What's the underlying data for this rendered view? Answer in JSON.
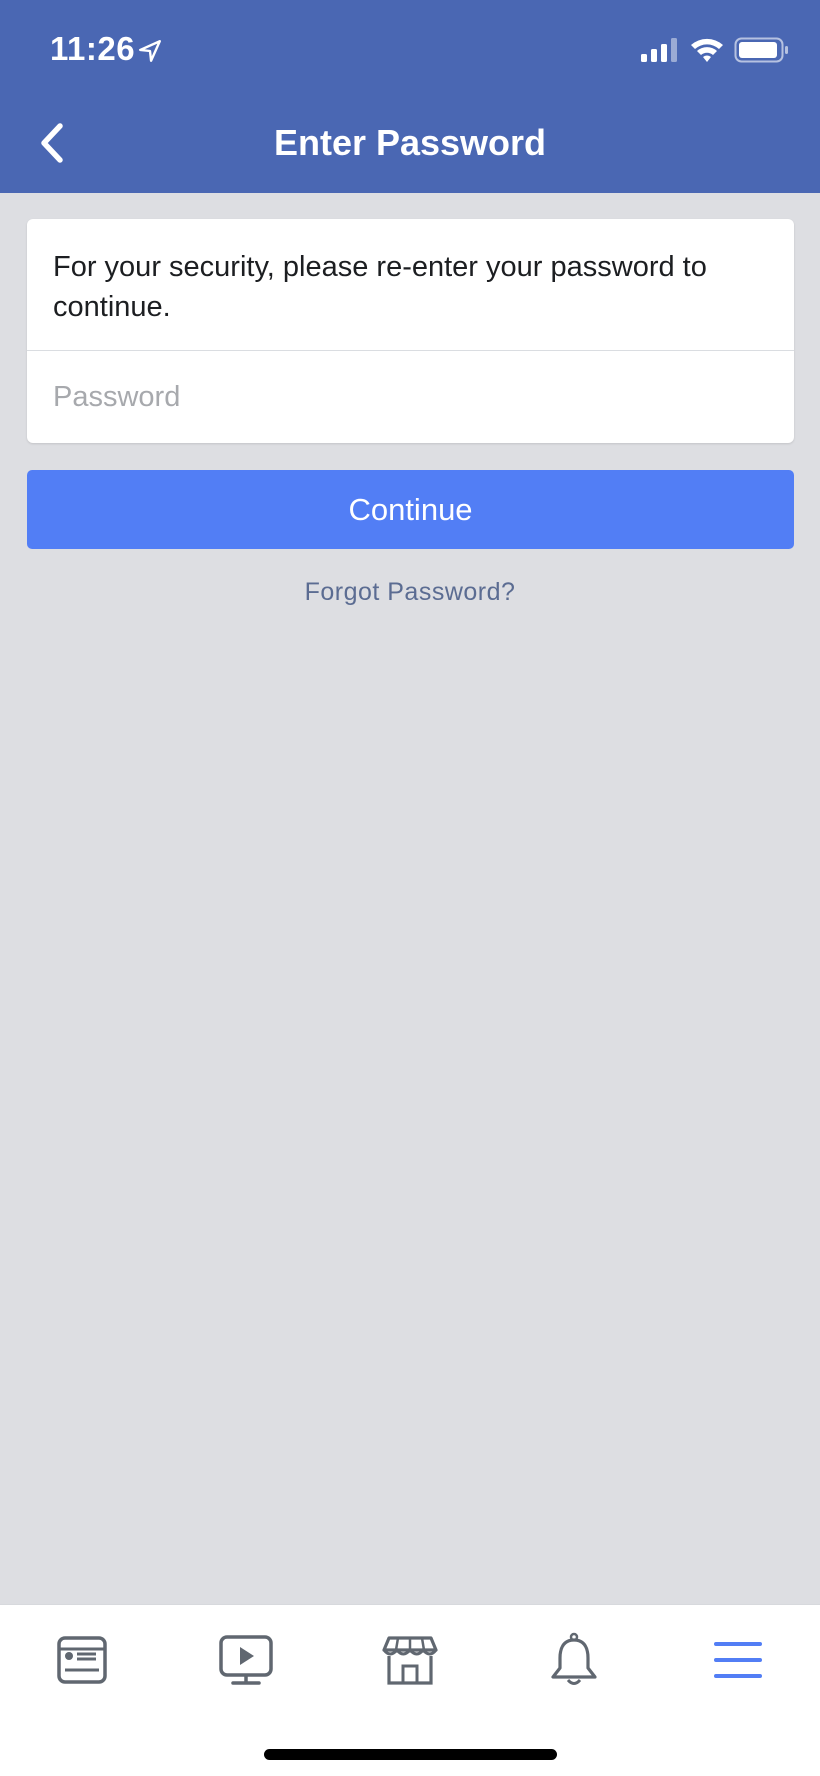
{
  "status_bar": {
    "time": "11:26"
  },
  "nav": {
    "title": "Enter Password"
  },
  "card": {
    "message": "For your security, please re-enter your password to continue.",
    "password_placeholder": "Password"
  },
  "actions": {
    "continue_label": "Continue",
    "forgot_label": "Forgot Password?"
  },
  "tab_bar": {
    "tabs": [
      {
        "icon": "news-feed-icon",
        "active": false
      },
      {
        "icon": "watch-video-icon",
        "active": false
      },
      {
        "icon": "marketplace-icon",
        "active": false
      },
      {
        "icon": "notifications-bell-icon",
        "active": false
      },
      {
        "icon": "menu-icon",
        "active": true
      }
    ]
  },
  "colors": {
    "header": "#4a67b3",
    "button": "#527ef5",
    "background": "#dddee2",
    "link": "#5b6c92",
    "active_tab": "#527ef5",
    "inactive_tab": "#606770"
  }
}
